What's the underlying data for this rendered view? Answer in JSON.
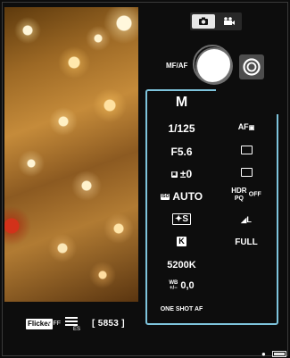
{
  "viewfinder": {
    "flicker_label": "Flicker",
    "flicker_state": "OFF",
    "menu_icon": "menu-lines-icon",
    "menu_sub": "ES",
    "shot_count": "[ 5853 ]"
  },
  "header": {
    "tab_photo_icon": "camera-icon",
    "tab_video_icon": "video-camera-icon"
  },
  "controls": {
    "focus_mode": "MF/AF",
    "shutter_icon": "shutter-button-icon",
    "record_icon": "record-icon"
  },
  "settings_left": {
    "mode": "M",
    "shutter": "1/125",
    "aperture": "F5.6",
    "exposure_comp": "±0",
    "iso": "AUTO",
    "picture_style": "S",
    "picture_style_prefix": "✦",
    "wb_icon": "K",
    "color_temp": "5200K",
    "wb_shift": "0,0",
    "af_operation": "ONE SHOT AF"
  },
  "settings_right": {
    "af_method": "AF",
    "hdr": "HDR",
    "hdr_sub": "PQ",
    "hdr_state": "OFF",
    "image_quality": "L",
    "movie_size": "FULL"
  },
  "status": {
    "battery_icon": "battery-icon",
    "camera_icon": "camera-small-icon"
  }
}
